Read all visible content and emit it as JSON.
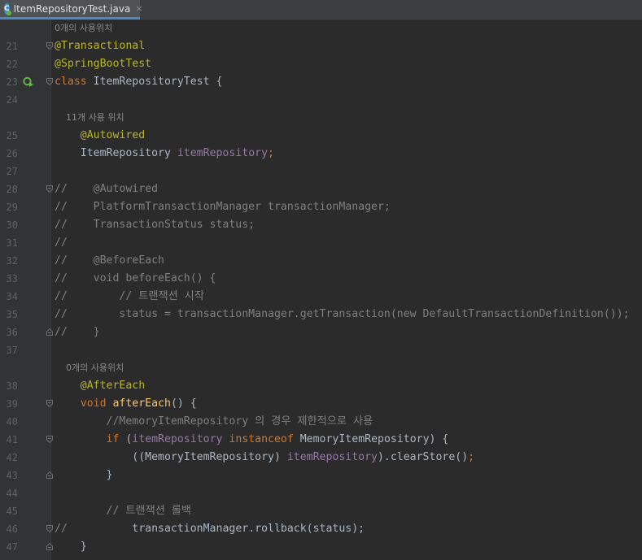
{
  "tab": {
    "title": "ItemRepositoryTest.java",
    "close": "×",
    "icon": "java-class-icon"
  },
  "lines": [
    {
      "hint": "0개의 사용위치"
    },
    {
      "num": "21",
      "parts": [
        [
          "ann",
          "@Transactional"
        ]
      ]
    },
    {
      "num": "22",
      "parts": [
        [
          "ann",
          "@SpringBootTest"
        ]
      ]
    },
    {
      "num": "23",
      "parts": [
        [
          "kw",
          "class "
        ],
        [
          "",
          "ItemRepositoryTest {"
        ]
      ]
    },
    {
      "num": "24",
      "parts": []
    },
    {
      "hint": "    11개 사용 위치"
    },
    {
      "num": "25",
      "parts": [
        [
          "ann",
          "    @Autowired"
        ]
      ]
    },
    {
      "num": "26",
      "parts": [
        [
          "",
          "    ItemRepository "
        ],
        [
          "fld",
          "itemRepository"
        ],
        [
          "kw",
          ";"
        ]
      ]
    },
    {
      "num": "27",
      "parts": []
    },
    {
      "num": "28",
      "parts": [
        [
          "cmt",
          "//    @Autowired"
        ]
      ]
    },
    {
      "num": "29",
      "parts": [
        [
          "cmt",
          "//    PlatformTransactionManager transactionManager;"
        ]
      ]
    },
    {
      "num": "30",
      "parts": [
        [
          "cmt",
          "//    TransactionStatus status;"
        ]
      ]
    },
    {
      "num": "31",
      "parts": [
        [
          "cmt",
          "//"
        ]
      ]
    },
    {
      "num": "32",
      "parts": [
        [
          "cmt",
          "//    @BeforeEach"
        ]
      ]
    },
    {
      "num": "33",
      "parts": [
        [
          "cmt",
          "//    void beforeEach() {"
        ]
      ]
    },
    {
      "num": "34",
      "parts": [
        [
          "cmt",
          "//        // 트랜잭션 시작"
        ]
      ]
    },
    {
      "num": "35",
      "parts": [
        [
          "cmt",
          "//        status = transactionManager.getTransaction(new DefaultTransactionDefinition());"
        ]
      ]
    },
    {
      "num": "36",
      "parts": [
        [
          "cmt",
          "//    }"
        ]
      ]
    },
    {
      "num": "37",
      "parts": []
    },
    {
      "hint": "    0개의 사용위치"
    },
    {
      "num": "38",
      "parts": [
        [
          "ann",
          "    @AfterEach"
        ]
      ]
    },
    {
      "num": "39",
      "parts": [
        [
          "kw",
          "    void "
        ],
        [
          "fn",
          "afterEach"
        ],
        [
          "",
          "() {"
        ]
      ]
    },
    {
      "num": "40",
      "parts": [
        [
          "cmt",
          "        //MemoryItemRepository 의 경우 제한적으로 사용"
        ]
      ]
    },
    {
      "num": "41",
      "parts": [
        [
          "kw",
          "        if "
        ],
        [
          "",
          "("
        ],
        [
          "fld",
          "itemRepository "
        ],
        [
          "kw",
          "instanceof "
        ],
        [
          "",
          "MemoryItemRepository) {"
        ]
      ]
    },
    {
      "num": "42",
      "parts": [
        [
          "",
          "            ((MemoryItemRepository) "
        ],
        [
          "fld",
          "itemRepository"
        ],
        [
          "",
          ").clearStore()"
        ],
        [
          "kw",
          ";"
        ]
      ]
    },
    {
      "num": "43",
      "parts": [
        [
          "",
          "        }"
        ]
      ]
    },
    {
      "num": "44",
      "parts": []
    },
    {
      "num": "45",
      "parts": [
        [
          "cmt",
          "        // 트랜잭션 롤백"
        ]
      ]
    },
    {
      "num": "46",
      "parts": [
        [
          "cmt",
          "//"
        ],
        [
          "",
          "          transactionManager.rollback(status);"
        ]
      ]
    },
    {
      "num": "47",
      "parts": [
        [
          "",
          "    }"
        ]
      ]
    }
  ],
  "icons": {
    "run": "run-test-icon",
    "fold": "fold-marker-icon"
  }
}
